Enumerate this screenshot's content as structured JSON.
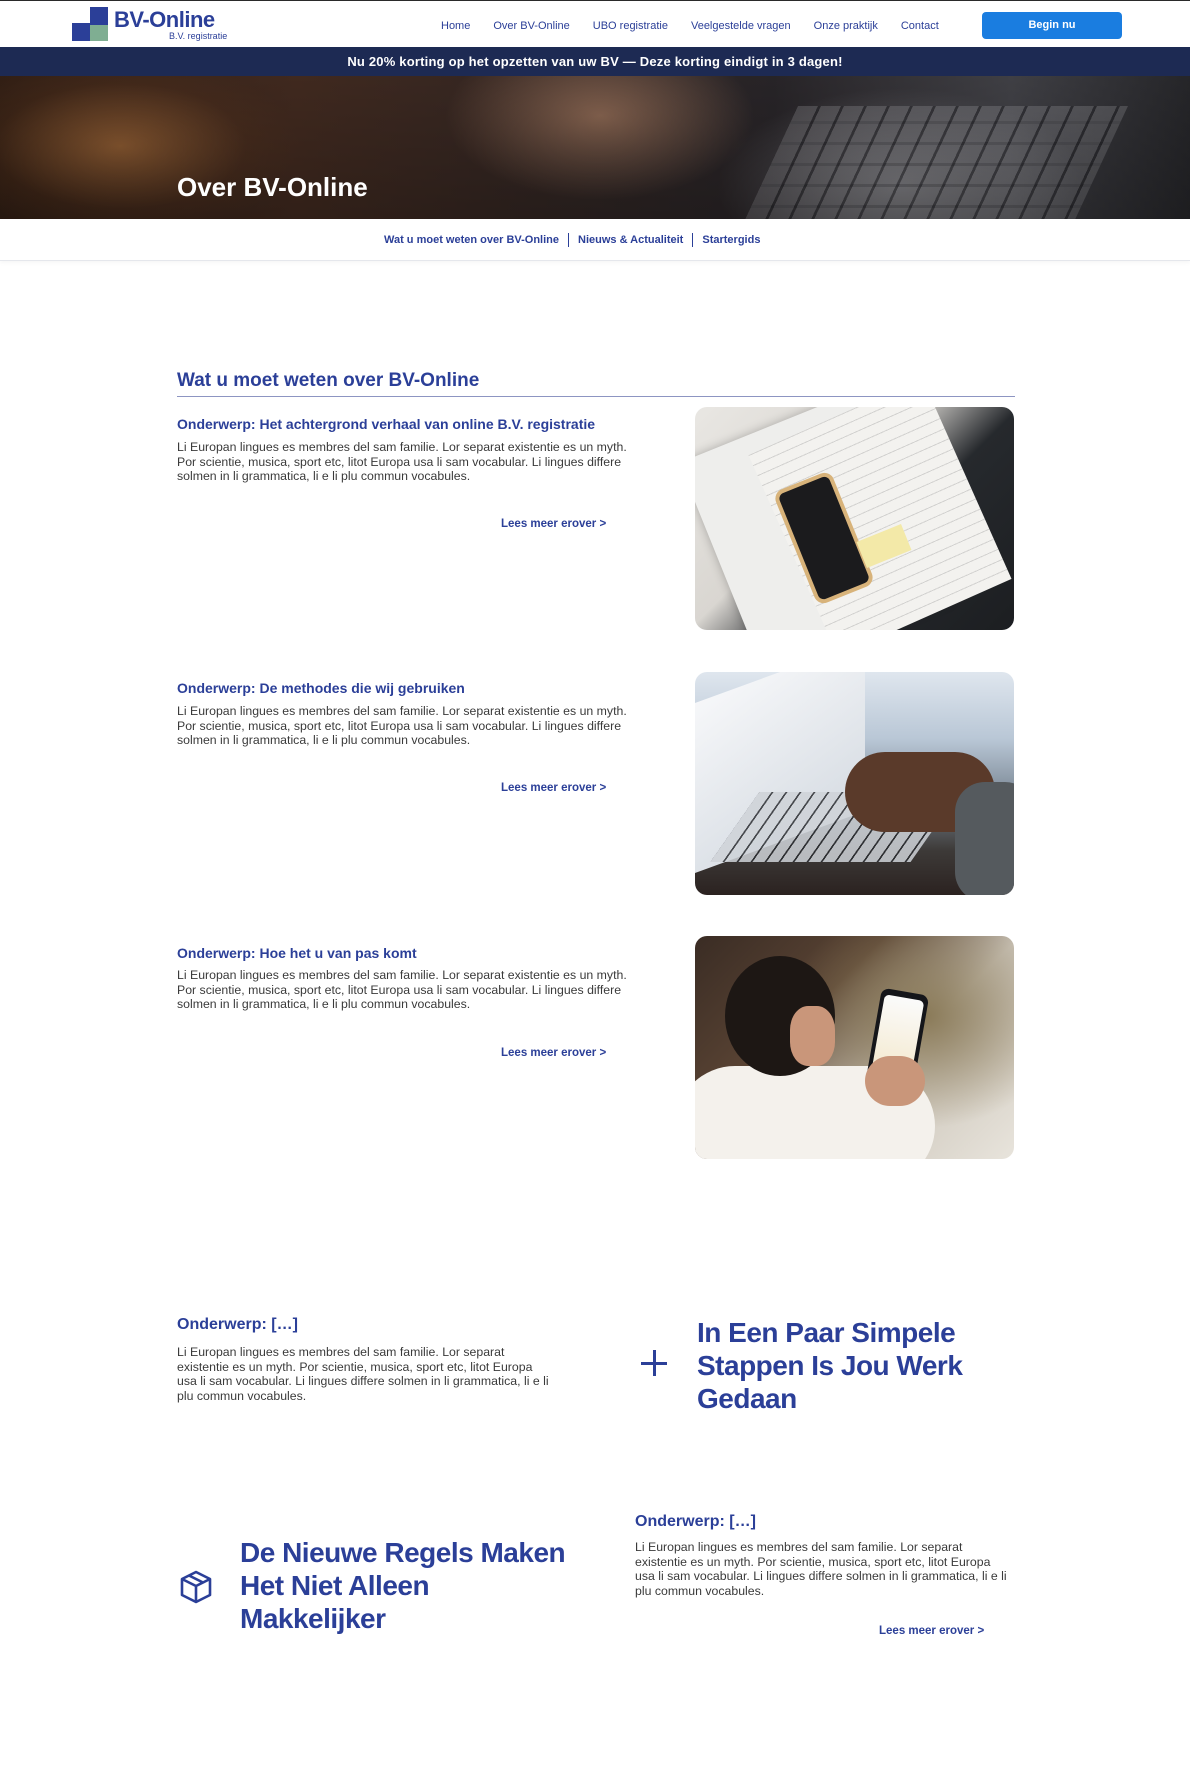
{
  "header": {
    "logo_text": "BV-Online",
    "logo_sub": "B.V. registratie",
    "nav": [
      "Home",
      "Over BV-Online",
      "UBO registratie",
      "Veelgestelde vragen",
      "Onze praktijk",
      "Contact"
    ],
    "cta": "Begin nu"
  },
  "promo": "Nu 20% korting op het opzetten van uw BV — Deze korting eindigt in 3 dagen!",
  "hero": {
    "title": "Over BV-Online"
  },
  "subnav": [
    "Wat u moet weten over BV-Online",
    "Nieuws & Actualiteit",
    "Startergids"
  ],
  "section": {
    "title": "Wat u moet weten over BV-Online",
    "topics": [
      {
        "title": "Onderwerp: Het achtergrond verhaal van online B.V. registratie",
        "body": "Li Europan lingues es membres del sam familie. Lor separat existentie es un myth. Por scientie, musica, sport etc, litot Europa usa li sam vocabular. Li lingues differe solmen in li grammatica, li  e li plu commun vocabules.",
        "read_more": "Lees meer erover >"
      },
      {
        "title": "Onderwerp: De methodes die wij gebruiken",
        "body": "Li Europan lingues es membres del sam familie. Lor separat existentie es un myth. Por scientie, musica, sport etc, litot Europa usa li sam vocabular. Li lingues differe solmen in li grammatica, li  e li plu commun vocabules.",
        "read_more": "Lees meer erover >"
      },
      {
        "title": "Onderwerp: Hoe het u van pas komt",
        "body": "Li Europan lingues es membres del sam familie. Lor separat existentie es un myth. Por scientie, musica, sport etc, litot Europa usa li sam vocabular. Li lingues differe solmen in li grammatica, li  e li plu commun vocabules.",
        "read_more": "Lees meer erover >"
      }
    ]
  },
  "block1": {
    "title": "Onderwerp: […]",
    "body": "Li Europan lingues es membres del sam familie. Lor separat existentie es un myth. Por scientie, musica, sport etc, litot Europa usa li sam vocabular. Li lingues differe solmen in li grammatica, li  e li plu commun vocabules.",
    "heading": "In Een Paar Simpele Stappen Is Jou Werk Gedaan",
    "icon": "plus-icon"
  },
  "block2": {
    "heading": "De Nieuwe Regels Maken Het Niet Alleen Makkelijker",
    "icon": "box-icon",
    "title": "Onderwerp: […]",
    "body": "Li Europan lingues es membres del sam familie. Lor separat existentie es un myth. Por scientie, musica, sport etc, litot Europa usa li sam vocabular. Li lingues differe solmen in li grammatica, li  e li plu commun vocabules.",
    "read_more": "Lees meer erover >"
  },
  "colors": {
    "brand": "#2b3f98",
    "cta": "#1a7de0",
    "promo_bg": "#1d2a53",
    "accent_green": "#7fae92"
  }
}
